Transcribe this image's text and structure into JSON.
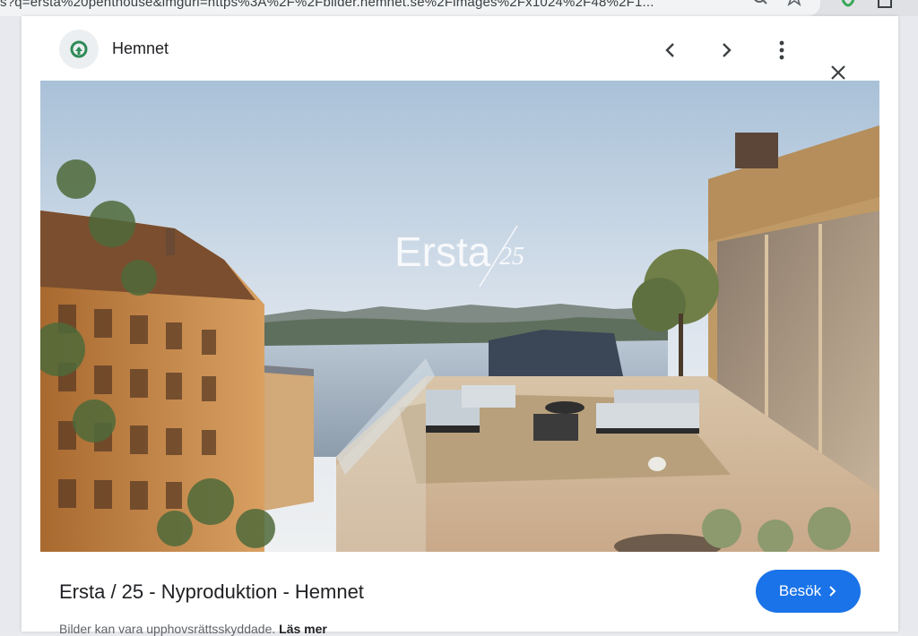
{
  "browser": {
    "url": "s?q=ersta%20penthouse&imgurl=https%3A%2F%2Fbilder.hemnet.se%2Fimages%2Fx1024%2F48%2F1..."
  },
  "viewer": {
    "source_name": "Hemnet",
    "prev_label": "Previous",
    "next_label": "Next",
    "more_label": "More options",
    "close_label": "Close",
    "image": {
      "overlay_text": "Ersta",
      "overlay_number": "25",
      "alt": "Ersta / 25 - Nyproduktion - Hemnet"
    },
    "title": "Ersta / 25 - Nyproduktion - Hemnet",
    "visit_label": "Besök",
    "copyright_text": "Bilder kan vara upphovsrättsskyddade.",
    "learn_more": "Läs mer"
  },
  "colors": {
    "accent": "#1a73e8",
    "text": "#202124",
    "muted": "#5f6368"
  }
}
